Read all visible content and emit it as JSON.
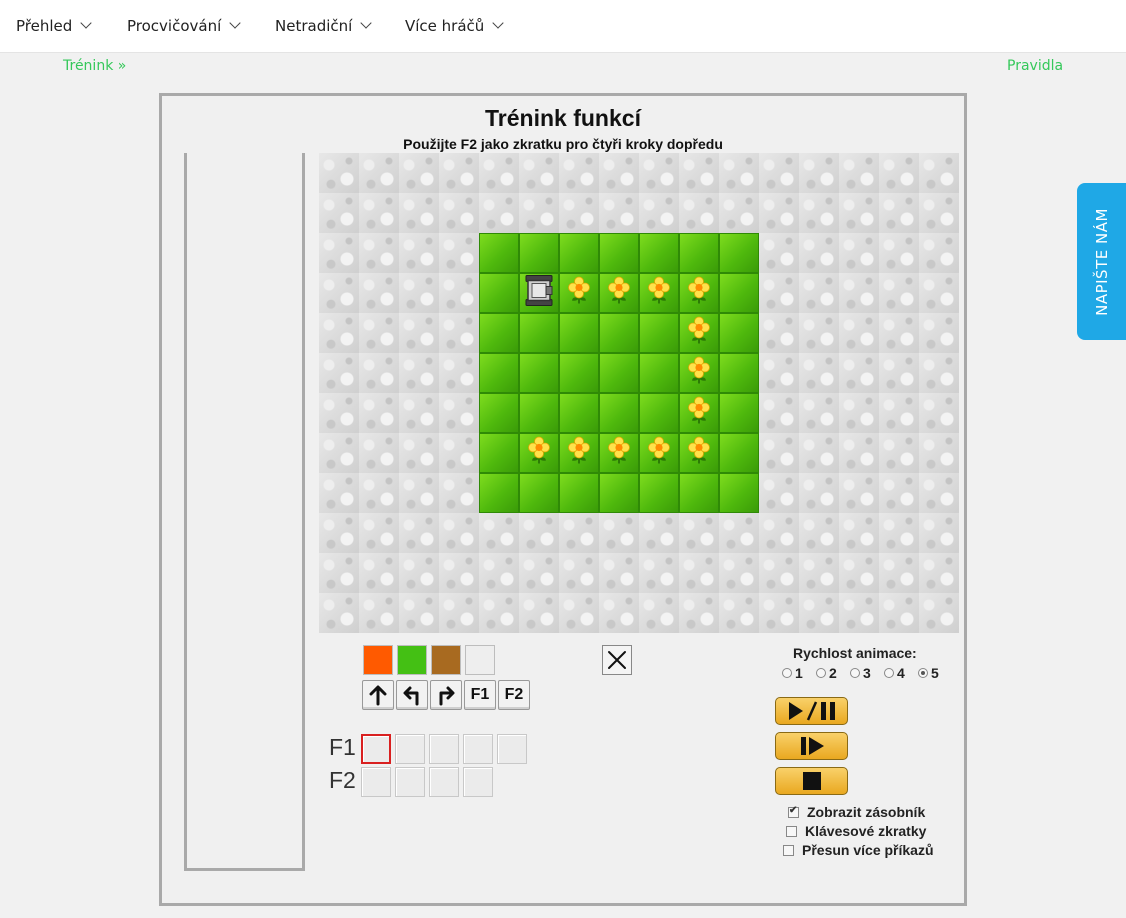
{
  "nav": {
    "items": [
      {
        "label": "Přehled"
      },
      {
        "label": "Procvičování"
      },
      {
        "label": "Netradiční"
      },
      {
        "label": "Více hráčů"
      }
    ]
  },
  "links": {
    "breadcrumb": "Trénink »",
    "rules": "Pravidla"
  },
  "game": {
    "title": "Trénink funkcí",
    "subtitle": "Použijte F2 jako zkratku pro čtyři kroky dopředu",
    "board": {
      "cols": 16,
      "rows": 12,
      "rows_data": [
        "................",
        "................",
        "....GGGGGGG.....",
        "....GRFFFFG.....",
        "....GGGGGFG.....",
        "....GGGGGFG.....",
        "....GGGGGFG.....",
        "....GFFFFFG.....",
        "....GGGGGGG.....",
        "................",
        "................",
        "................"
      ],
      "legend": {
        ".": "stone",
        "G": "grass",
        "F": "grass-flower",
        "R": "grass-robot"
      }
    },
    "palette_colors": [
      "#ff5a00",
      "#44c014",
      "#a86a20",
      "#eeeeee"
    ],
    "commands": [
      {
        "icon": "arrow-up-icon",
        "label": ""
      },
      {
        "icon": "turn-left-icon",
        "label": ""
      },
      {
        "icon": "turn-right-icon",
        "label": ""
      },
      {
        "icon": "",
        "label": "F1"
      },
      {
        "icon": "",
        "label": "F2"
      }
    ],
    "functions": [
      {
        "label": "F1",
        "slots": 5
      },
      {
        "label": "F2",
        "slots": 4
      }
    ],
    "speed": {
      "label": "Rychlost animace:",
      "options": [
        "1",
        "2",
        "3",
        "4",
        "5"
      ],
      "selected": "5"
    },
    "controls": [
      "play-pause-icon",
      "step-icon",
      "stop-icon"
    ],
    "options": [
      {
        "label": "Zobrazit zásobník",
        "checked": true
      },
      {
        "label": "Klávesové zkratky",
        "checked": false
      },
      {
        "label": "Přesun více příkazů",
        "checked": false
      }
    ]
  },
  "feedback": {
    "label": "NAPIŠTE NÁM"
  }
}
